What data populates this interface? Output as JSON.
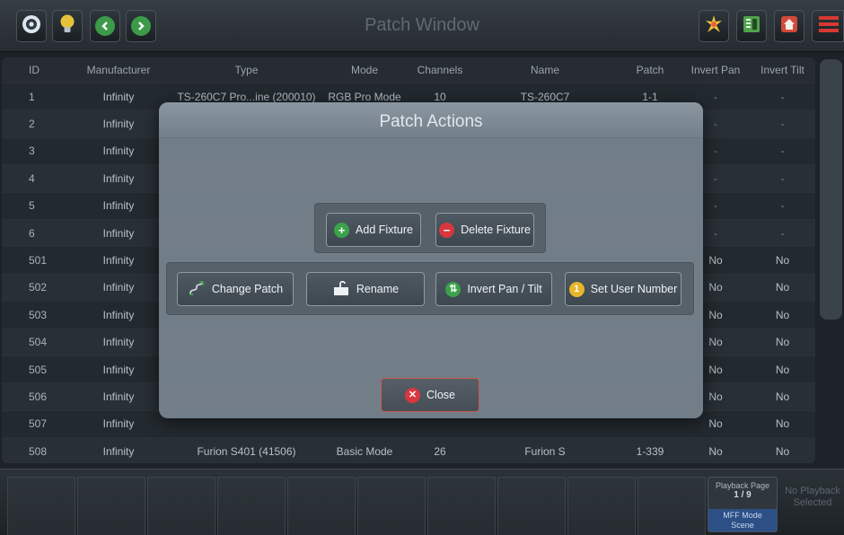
{
  "window": {
    "title": "Patch Window"
  },
  "toolbar": {
    "left_icons": [
      "eye-icon",
      "lightbulb-icon",
      "chevron-left-icon",
      "chevron-right-icon"
    ],
    "right_icons": [
      "sparkle-icon",
      "fixture-grid-icon",
      "home-icon",
      "menu-icon"
    ]
  },
  "table": {
    "columns": [
      "ID",
      "Manufacturer",
      "Type",
      "Mode",
      "Channels",
      "Name",
      "Patch",
      "Invert Pan",
      "Invert Tilt"
    ],
    "rows": [
      [
        "1",
        "Infinity",
        "TS-260C7 Pro...ine (200010)",
        "RGB Pro Mode",
        "10",
        "TS-260C7",
        "1-1",
        "-",
        "-"
      ],
      [
        "2",
        "Infinity",
        "",
        "",
        "",
        "",
        "",
        "-",
        "-"
      ],
      [
        "3",
        "Infinity",
        "",
        "",
        "",
        "",
        "",
        "-",
        "-"
      ],
      [
        "4",
        "Infinity",
        "",
        "",
        "",
        "",
        "",
        "-",
        "-"
      ],
      [
        "5",
        "Infinity",
        "",
        "",
        "",
        "",
        "",
        "-",
        "-"
      ],
      [
        "6",
        "Infinity",
        "",
        "",
        "",
        "",
        "",
        "-",
        "-"
      ],
      [
        "501",
        "Infinity",
        "",
        "",
        "",
        "",
        "",
        "No",
        "No"
      ],
      [
        "502",
        "Infinity",
        "",
        "",
        "",
        "",
        "",
        "No",
        "No"
      ],
      [
        "503",
        "Infinity",
        "",
        "",
        "",
        "",
        "",
        "No",
        "No"
      ],
      [
        "504",
        "Infinity",
        "",
        "",
        "",
        "",
        "",
        "No",
        "No"
      ],
      [
        "505",
        "Infinity",
        "",
        "",
        "",
        "",
        "",
        "No",
        "No"
      ],
      [
        "506",
        "Infinity",
        "",
        "",
        "",
        "",
        "",
        "No",
        "No"
      ],
      [
        "507",
        "Infinity",
        "",
        "",
        "",
        "",
        "",
        "No",
        "No"
      ],
      [
        "508",
        "Infinity",
        "Furion S401 (41506)",
        "Basic Mode",
        "26",
        "Furion S",
        "1-339",
        "No",
        "No"
      ]
    ]
  },
  "dialog": {
    "title": "Patch Actions",
    "add_fixture": "Add Fixture",
    "delete_fixture": "Delete Fixture",
    "change_patch": "Change Patch",
    "rename": "Rename",
    "invert_pan_tilt": "Invert Pan / Tilt",
    "set_user_number": "Set User Number",
    "close": "Close"
  },
  "bottom": {
    "playback_page_label": "Playback Page",
    "playback_page_value": "1 / 9",
    "mff_mode_label": "MFF Mode",
    "mff_mode_value": "Scene",
    "no_playback": "No Playback Selected"
  },
  "colors": {
    "accent_green": "#3aa24a",
    "accent_red": "#d9363e",
    "accent_yellow": "#e7b62a",
    "mff_blue": "#2c4f86"
  }
}
